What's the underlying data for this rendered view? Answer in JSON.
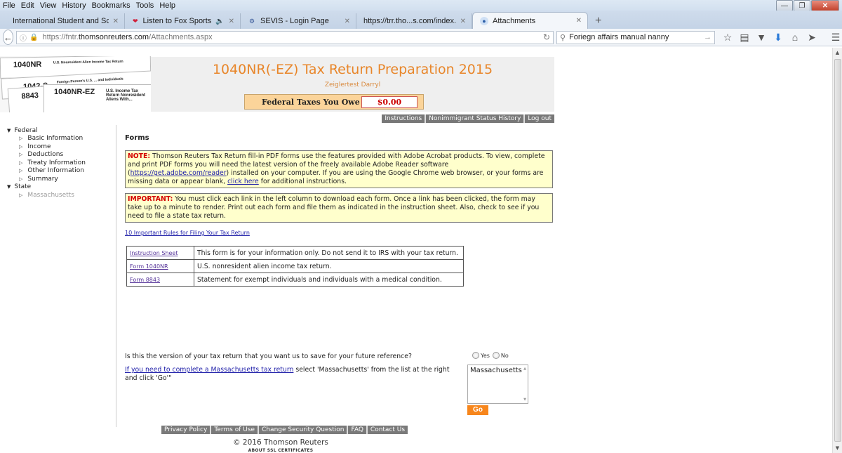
{
  "browser": {
    "menu": [
      "File",
      "Edit",
      "View",
      "History",
      "Bookmarks",
      "Tools",
      "Help"
    ],
    "tabs": [
      {
        "title": "International Student and Scho...",
        "favicon": "blank-icon",
        "active": false
      },
      {
        "title": "Listen to Fox Sports Ra...",
        "favicon": "iheart-icon",
        "audio": true,
        "active": false
      },
      {
        "title": "SEVIS - Login Page",
        "favicon": "seal-icon",
        "active": false
      },
      {
        "title": "https://trr.tho...s.com/index.php",
        "favicon": "none",
        "active": false
      },
      {
        "title": "Attachments",
        "favicon": "globe-icon",
        "active": true
      }
    ],
    "url_prefix": "https://fntr.",
    "url_domain": "thomsonreuters.com",
    "url_path": "/Attachments.aspx",
    "search_value": "Foriegn affairs manual nanny"
  },
  "header": {
    "title": "1040NR(-EZ) Tax Return Preparation 2015",
    "user_name": "Zeiglertest Darryl",
    "tax_owe_label": "Federal Taxes You Owe",
    "tax_owe_value": "$0.00",
    "image_forms": [
      {
        "number": "1040NR",
        "title": "U.S. Nonresident Alien Income Tax Return"
      },
      {
        "number": "1042-S",
        "title": "Foreign Person's U.S. ... and Individuals"
      },
      {
        "number": "8843",
        "title": ""
      },
      {
        "number": "1040NR-EZ",
        "title": "U.S. Income Tax Return Nonresident Aliens With..."
      }
    ]
  },
  "top_nav": [
    "Instructions",
    "Nonimmigrant Status History",
    "Log out"
  ],
  "sidebar": {
    "groups": [
      {
        "label": "Federal",
        "items": [
          {
            "label": "Basic Information",
            "disabled": false
          },
          {
            "label": "Income",
            "disabled": false
          },
          {
            "label": "Deductions",
            "disabled": false
          },
          {
            "label": "Treaty Information",
            "disabled": false
          },
          {
            "label": "Other Information",
            "disabled": false
          },
          {
            "label": "Summary",
            "disabled": false
          }
        ]
      },
      {
        "label": "State",
        "items": [
          {
            "label": "Massachusetts",
            "disabled": true
          }
        ]
      }
    ]
  },
  "content": {
    "title": "Forms",
    "note": {
      "label": "NOTE:",
      "text1": " Thomson Reuters Tax Return fill-in PDF forms use the features provided with Adobe Acrobat products. To view, complete and print PDF forms you will need the latest version of the freely available Adobe Reader software (",
      "link1": "https://get.adobe.com/reader",
      "text2": ") installed on your computer. If you are using the Google Chrome web browser, or your forms are missing data or appear blank, ",
      "link2": "click here",
      "text3": " for additional instructions."
    },
    "important": {
      "label": "IMPORTANT:",
      "text": " You must click each link in the left column to download each form. Once a link has been clicked, the form may take up to a minute to render. Print out each form and file them as indicated in the instruction sheet. Also, check to see if you need to file a state tax return."
    },
    "rules_link": "10 Important Rules for Filing Your Tax Return",
    "forms": [
      {
        "link": "Instruction Sheet",
        "description": "This form is for your information only. Do not send it to IRS with your tax return."
      },
      {
        "link": "Form 1040NR",
        "description": "U.S. nonresident alien income tax return."
      },
      {
        "link": "Form 8843",
        "description": "Statement for exempt individuals and individuals with a medical condition."
      }
    ],
    "save_question": "Is this the version of your tax return that you want us to save for your future reference?",
    "radio_yes": "Yes",
    "radio_no": "No",
    "ma_link": "If you need to complete a Massachusetts tax return",
    "ma_text": " select 'Massachusetts' from the list at the right and click 'Go'\"",
    "state_options": [
      "Massachusetts"
    ],
    "go_label": "Go"
  },
  "footer": {
    "links": [
      "Privacy Policy",
      "Terms of Use",
      "Change Security Question",
      "FAQ",
      "Contact Us"
    ],
    "copyright": "© 2016 Thomson Reuters",
    "ssl": "ABOUT SSL CERTIFICATES"
  },
  "colors": {
    "accent_orange": "#e8862a",
    "note_bg": "#ffffcc",
    "note_label": "#d40000",
    "tax_box_bg": "#fbd49a",
    "go_button": "#f7861c"
  }
}
